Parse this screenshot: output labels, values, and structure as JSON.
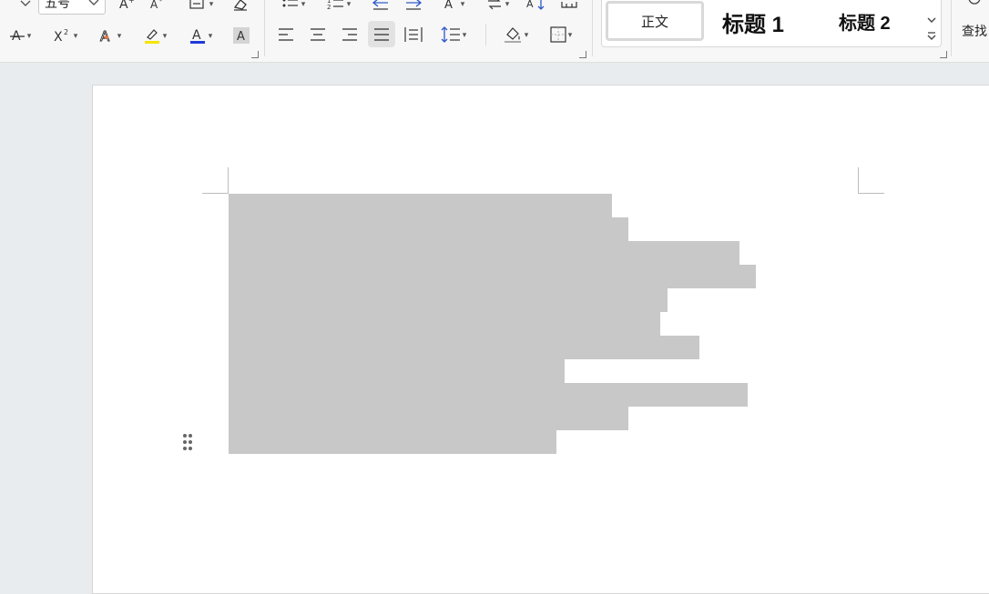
{
  "ribbon": {
    "font_size": {
      "value": "五号"
    },
    "styles": {
      "normal": "正文",
      "heading1": "标题 1",
      "heading2": "标题 2"
    },
    "find_label": "查找",
    "icons": [
      "strikethrough-icon",
      "superscript-icon",
      "text-effect-icon",
      "highlight-color-icon",
      "font-color-icon",
      "character-shading-icon",
      "grow-font-icon",
      "shrink-font-icon",
      "phonetic-guide-icon",
      "clear-format-icon",
      "bullets-icon",
      "numbering-icon",
      "decrease-indent-icon",
      "increase-indent-icon",
      "align-left-icon",
      "align-center-icon",
      "align-right-icon",
      "justify-icon",
      "distributed-icon",
      "line-spacing-icon",
      "shading-icon",
      "borders-icon",
      "more-styles-icon"
    ],
    "colors": {
      "highlight": "#f5e400",
      "font_color": "#1e3cd6",
      "active_button_bg": "#e2e2e2"
    }
  },
  "document": {
    "redaction_color": "#c8c8c8",
    "paragraph_count": 11
  }
}
